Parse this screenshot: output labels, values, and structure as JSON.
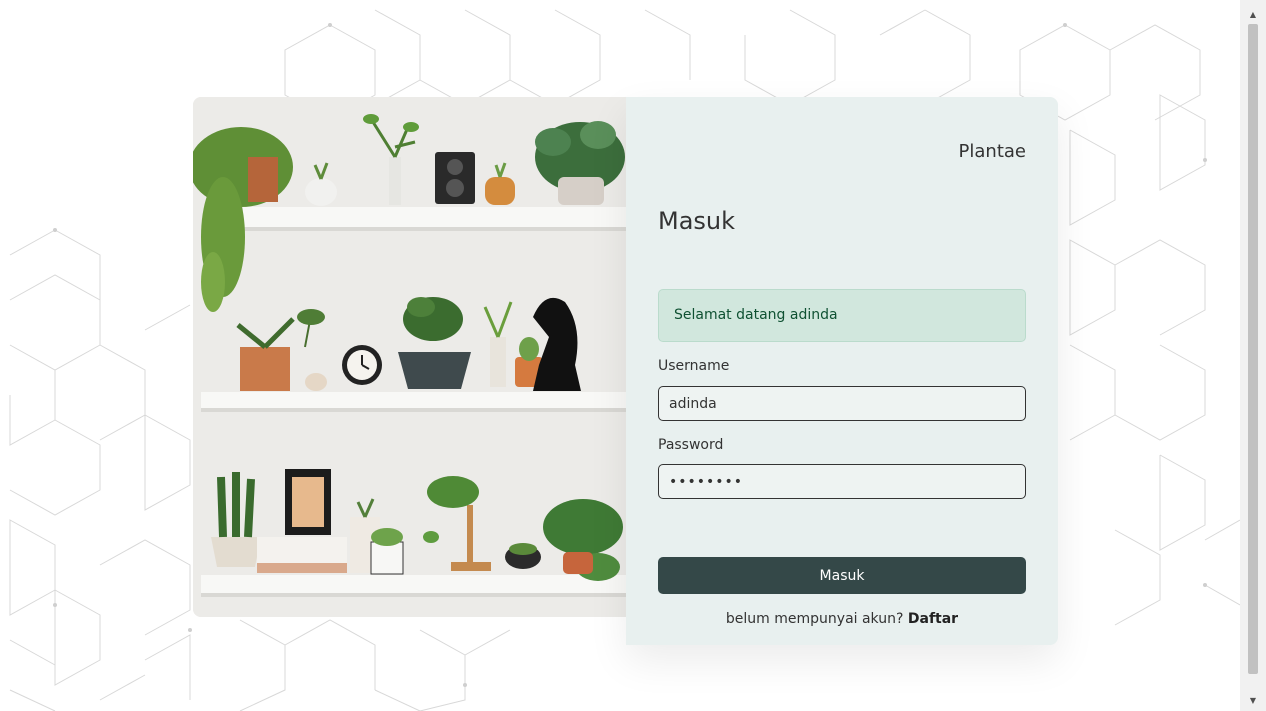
{
  "brand": "Plantae",
  "title": "Masuk",
  "alert_message": "Selamat datang adinda",
  "form": {
    "username_label": "Username",
    "username_value": "adinda",
    "password_label": "Password",
    "password_value": "••••••••",
    "submit_label": "Masuk"
  },
  "register": {
    "prompt": "belum mempunyai akun?",
    "link_label": "Daftar"
  },
  "colors": {
    "panel_bg": "#e8f0ef",
    "button_bg": "#344848",
    "alert_bg": "#d1e7dd",
    "alert_text": "#0f5132"
  }
}
